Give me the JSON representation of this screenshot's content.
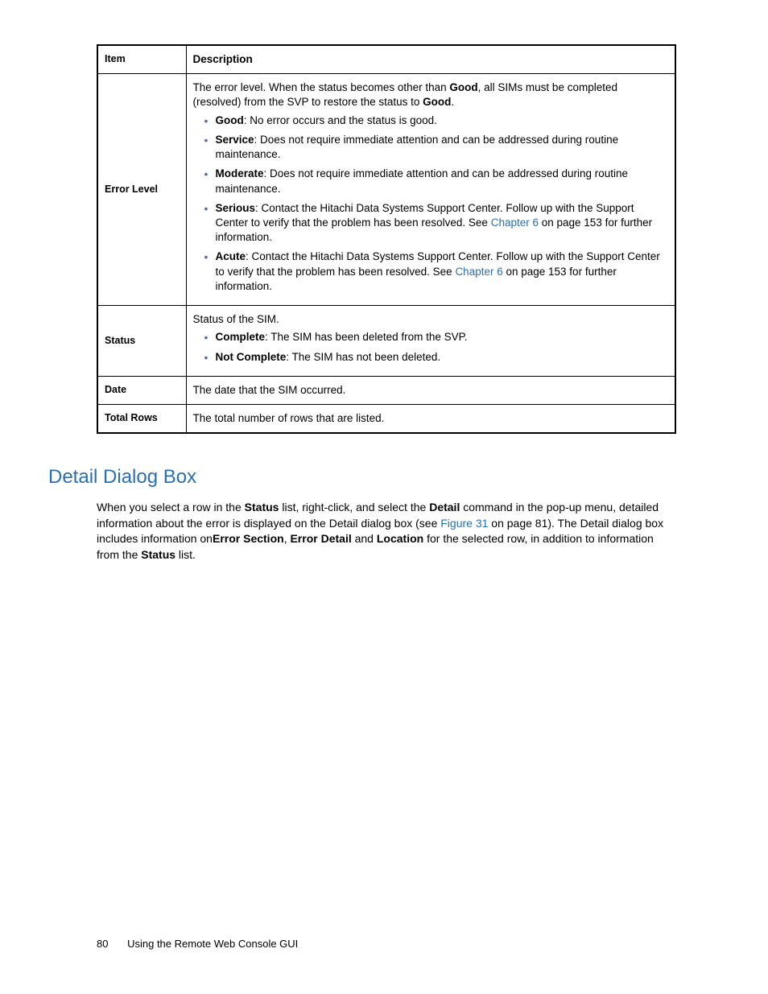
{
  "table": {
    "headers": {
      "item": "Item",
      "desc": "Description"
    },
    "rows": {
      "errorLevel": {
        "label": "Error Level",
        "intro_a": "The error level. When the status becomes other than ",
        "intro_good1": "Good",
        "intro_b": ", all SIMs must be completed (resolved) from the SVP to restore the status to ",
        "intro_good2": "Good",
        "intro_c": ".",
        "bullets": {
          "good": {
            "name": "Good",
            "text": ": No error occurs and the status is good."
          },
          "service": {
            "name": "Service",
            "text": ": Does not require immediate attention and can be addressed during routine maintenance."
          },
          "moderate": {
            "name": "Moderate",
            "text": ": Does not require immediate attention and can be addressed during routine maintenance."
          },
          "serious": {
            "name": "Serious",
            "pre": ": Contact the Hitachi Data Systems Support Center. Follow up with the Support Center to verify that the problem has been resolved. See ",
            "link": "Chapter 6",
            "post": " on page 153 for further information."
          },
          "acute": {
            "name": "Acute",
            "pre": ": Contact the Hitachi Data Systems Support Center. Follow up with the Support Center to verify that the problem has been resolved. See ",
            "link": "Chapter 6",
            "post": " on page 153 for further information."
          }
        }
      },
      "status": {
        "label": "Status",
        "intro": "Status of the SIM.",
        "bullets": {
          "complete": {
            "name": "Complete",
            "text": ": The SIM has been deleted from the SVP."
          },
          "notcomplete": {
            "name": "Not Complete",
            "text": ": The SIM has not been deleted."
          }
        }
      },
      "date": {
        "label": "Date",
        "text": "The date that the SIM occurred."
      },
      "totalrows": {
        "label": "Total Rows",
        "text": "The total number of rows that are listed."
      }
    }
  },
  "section": {
    "heading": "Detail Dialog Box",
    "p": {
      "a": "When you select a row in the ",
      "status": "Status",
      "b": " list, right-click, and select the ",
      "detail": "Detail",
      "c": " command in the pop-up menu, detailed information about the error is displayed on the Detail dialog box (see ",
      "figlink": "Figure 31",
      "d": " on page 81). The Detail dialog box includes information on",
      "errsec": "Error Section",
      "e": ", ",
      "errdet": "Error Detail",
      "f": " and ",
      "loc": "Location",
      "g": " for the selected row, in addition to information from the ",
      "status2": "Status",
      "h": " list."
    }
  },
  "footer": {
    "pagenum": "80",
    "title": "Using the Remote Web Console GUI"
  }
}
